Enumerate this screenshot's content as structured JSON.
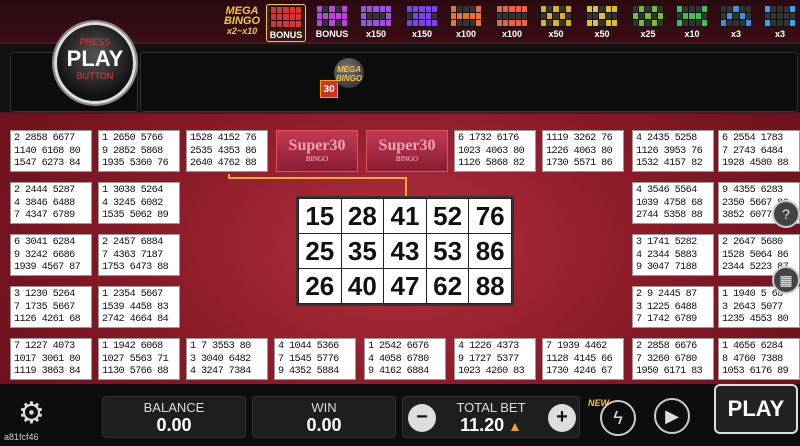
{
  "topbar": {
    "mega_logo": [
      "MEGA",
      "BINGO",
      "x2~x10"
    ],
    "patterns": [
      {
        "label": "BONUS",
        "color": "#e03030"
      },
      {
        "label": "BONUS",
        "color": "#c040e0"
      },
      {
        "label": "x150",
        "color": "#a050e0"
      },
      {
        "label": "x150",
        "color": "#8040f0"
      },
      {
        "label": "x100",
        "color": "#f07030"
      },
      {
        "label": "x100",
        "color": "#f06040"
      },
      {
        "label": "x50",
        "color": "#e0b020"
      },
      {
        "label": "x50",
        "color": "#e0c030"
      },
      {
        "label": "x25",
        "color": "#70c030"
      },
      {
        "label": "x10",
        "color": "#40c050"
      },
      {
        "label": "x3",
        "color": "#4090e0"
      },
      {
        "label": "x3",
        "color": "#40a0f0"
      }
    ]
  },
  "press_play": {
    "line1": "PRESS",
    "line2": "PLAY",
    "line3": "BUTTON"
  },
  "rail": {
    "ball_number": "30",
    "mega_ball": [
      "MEGA",
      "BINGO"
    ]
  },
  "cards_left": [
    [
      "2 2858 6677",
      "1140 6168 80",
      "1547 6273 84"
    ],
    [
      "2 2444 5287",
      "4 3846 6488",
      "7 4347 6789"
    ],
    [
      "6 3041 6284",
      "9 3242 6686",
      "1939 4567 87"
    ],
    [
      "3 1230 5264",
      "7 1735 5667",
      "1126 4261 68"
    ],
    [
      "7 1227 4073",
      "1017 3061 80",
      "1119 3863 84"
    ]
  ],
  "cards_col2": [
    [
      "1 2650 5766",
      "9 2852 5868",
      "1935 5360 76"
    ],
    [
      "1 3038 5264",
      "4 3245 6082",
      "1535 5062 89"
    ],
    [
      "2 2457 6884",
      "7 4363 7187",
      "1753 6473 88"
    ],
    [
      "1 2354 5667",
      "1539 4458 83",
      "2742 4664 84"
    ],
    [
      "1 1942 6068",
      "1027 5563 71",
      "1130 5766 88"
    ]
  ],
  "cards_top_middle": [
    [
      "1528 4152 76",
      "2535 4353 86",
      "2640 4762 88"
    ],
    [
      "6 1732 6176",
      "1023 4063 80",
      "1126 5868 82"
    ],
    [
      "1119 3262 76",
      "1226 4063 80",
      "1730 5571 86"
    ]
  ],
  "cards_bottom_middle": [
    [
      "1 7 3553 80",
      "3 3040 6482",
      "4 3247 7384"
    ],
    [
      "4 1044 5366",
      "7 1545 5776",
      "9 4352 5884"
    ],
    [
      "1 2542 6676",
      "4 4058 6780",
      "9 4162 6884"
    ],
    [
      "4 1226 4373",
      "9 1727 5377",
      "1023 4260 83"
    ],
    [
      "7 1939 4462",
      "1128 4145 66",
      "1730 4246 67"
    ]
  ],
  "cards_right": [
    [
      "4 2435 5258",
      "1126 3953 76",
      "1532 4157 82"
    ],
    [
      "4 3546 5564",
      "1039 4758 68",
      "2744 5358 88"
    ],
    [
      "3 1741 5282",
      "4 2344 5883",
      "9 3047 7188"
    ],
    [
      "2 9 2445 87",
      "3 1225 6488",
      "7 1742 6789"
    ],
    [
      "2 2858 6676",
      "7 3260 6780",
      "1950 6171 83"
    ]
  ],
  "cards_far_right": [
    [
      "6 2554 1783",
      "7 2743 6484",
      "1928 4580 88"
    ],
    [
      "9 4355 6283",
      "2350 5667 86",
      "3852 6077 88"
    ],
    [
      "2 2647 5680",
      "1528 5064 86",
      "2344 5223 87"
    ],
    [
      "1 1940 5 68",
      "3 2643 5077",
      "1235 4553 80"
    ],
    [
      "1 4656 6284",
      "8 4760 7388",
      "1053 6176 89"
    ]
  ],
  "super30": {
    "title": "Super30",
    "sub": "BINGO"
  },
  "big_card": [
    [
      "15",
      "28",
      "41",
      "52",
      "76"
    ],
    [
      "25",
      "35",
      "43",
      "53",
      "86"
    ],
    [
      "26",
      "40",
      "47",
      "62",
      "88"
    ]
  ],
  "bottom": {
    "balance_label": "BALANCE",
    "balance_value": "0.00",
    "win_label": "WIN",
    "win_value": "0.00",
    "total_bet_label": "TOTAL BET",
    "total_bet_value": "11.20",
    "minus": "−",
    "plus": "+",
    "new_tag": "NEW",
    "play_label": "PLAY",
    "session_code": "a81fcf46"
  },
  "icons": {
    "settings": "gear-icon",
    "turbo": "lightning-icon",
    "autoplay": "autoplay-icon",
    "help": "help-icon",
    "paytable": "grid-icon"
  }
}
